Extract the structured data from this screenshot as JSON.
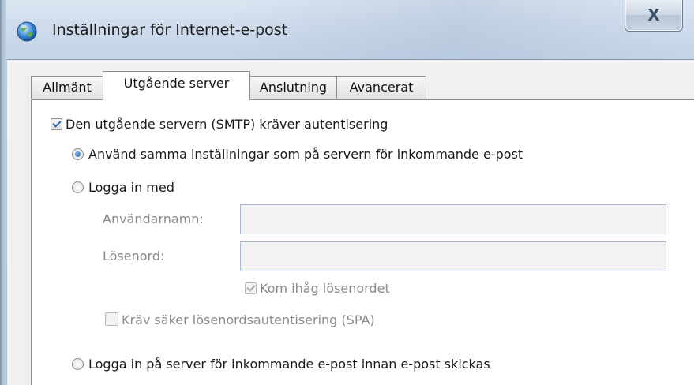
{
  "window": {
    "title": "Inställningar för Internet-e-post",
    "close_glyph": "X"
  },
  "tabs": [
    {
      "label": "Allmänt",
      "active": false
    },
    {
      "label": "Utgående server",
      "active": true
    },
    {
      "label": "Anslutning",
      "active": false
    },
    {
      "label": "Avancerat",
      "active": false
    }
  ],
  "outgoing": {
    "smtp_auth_label": "Den utgående servern (SMTP) kräver autentisering",
    "smtp_auth_checked": true,
    "same_settings_label": "Använd samma inställningar som på servern för inkommande e-post",
    "same_settings_selected": true,
    "login_with_label": "Logga in med",
    "username_label": "Användarnamn:",
    "username_value": "",
    "password_label": "Lösenord:",
    "password_value": "",
    "remember_password_label": "Kom ihåg lösenordet",
    "remember_password_checked": true,
    "spa_label": "Kräv säker lösenordsautentisering (SPA)",
    "spa_checked": false,
    "login_incoming_first_label": "Logga in på server för inkommande e-post innan e-post skickas"
  },
  "colors": {
    "accent": "#1a5fb4",
    "disabled_text": "#8a8a8a"
  },
  "icons": {
    "app": "mail-settings-globe-icon",
    "close": "close-icon"
  }
}
